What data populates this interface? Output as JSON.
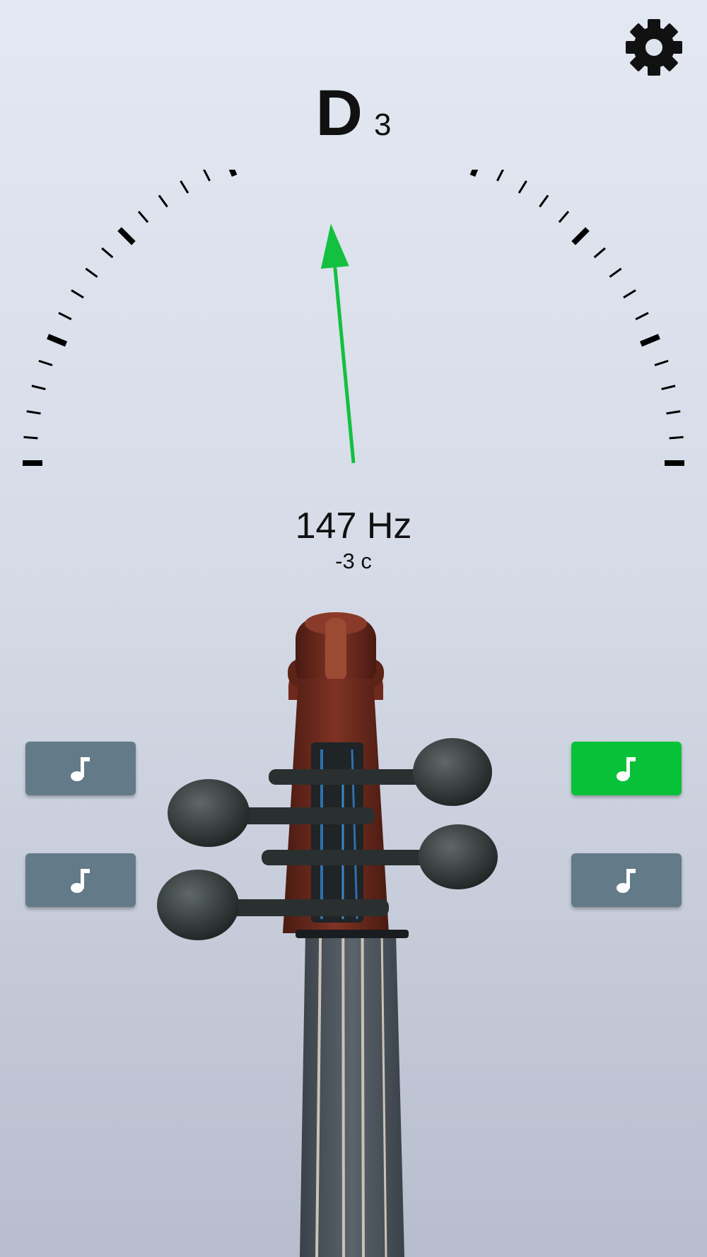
{
  "tuner": {
    "note": "D",
    "octave": "3",
    "frequency": "147 Hz",
    "cents": "-3 c",
    "needle_cents": -3
  },
  "colors": {
    "needle": "#13c03f",
    "active_string": "#07c238",
    "inactive_string": "#637a88"
  },
  "icons": {
    "settings": "gear-icon",
    "string_button": "music-note-icon"
  },
  "string_buttons": [
    {
      "side": "left",
      "row": 1,
      "active": false
    },
    {
      "side": "left",
      "row": 2,
      "active": false
    },
    {
      "side": "right",
      "row": 1,
      "active": true
    },
    {
      "side": "right",
      "row": 2,
      "active": false
    }
  ]
}
